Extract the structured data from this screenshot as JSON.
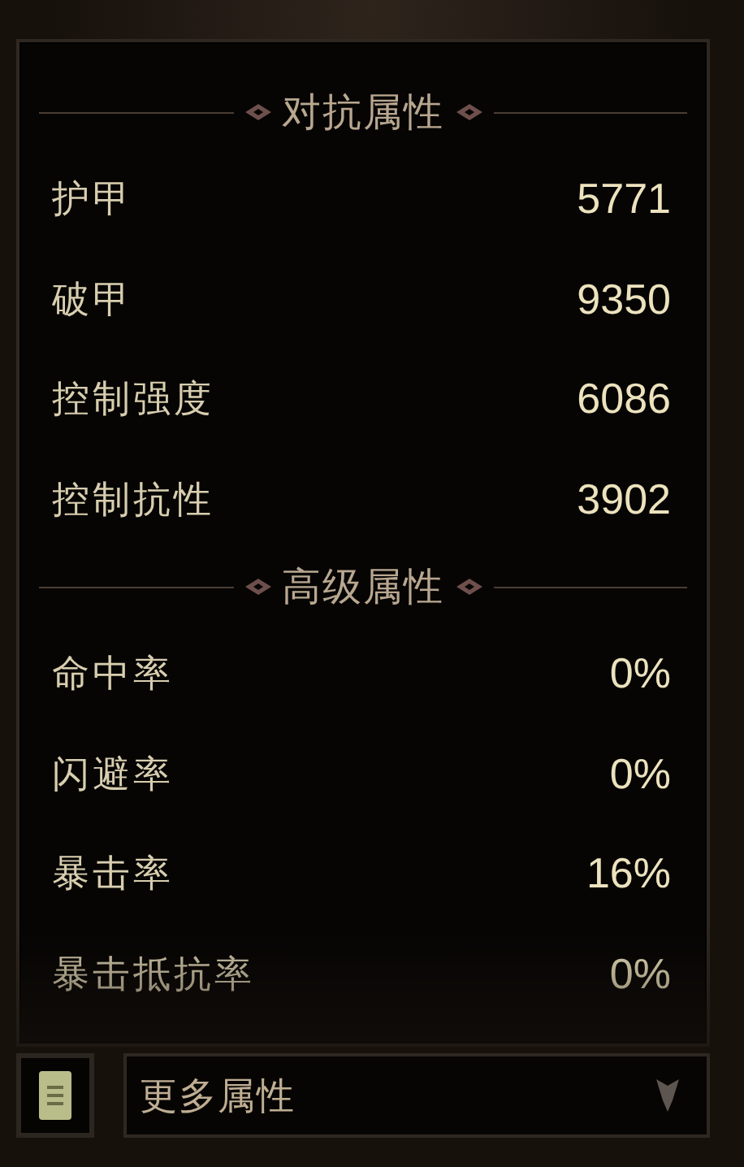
{
  "sections": [
    {
      "title": "对抗属性",
      "rows": [
        {
          "label": "护甲",
          "value": "5771"
        },
        {
          "label": "破甲",
          "value": "9350"
        },
        {
          "label": "控制强度",
          "value": "6086"
        },
        {
          "label": "控制抗性",
          "value": "3902"
        }
      ]
    },
    {
      "title": "高级属性",
      "rows": [
        {
          "label": "命中率",
          "value": "0%"
        },
        {
          "label": "闪避率",
          "value": "0%"
        },
        {
          "label": "暴击率",
          "value": "16%"
        },
        {
          "label": "暴击抵抗率",
          "value": "0%"
        }
      ]
    }
  ],
  "dropdown": {
    "label": "更多属性"
  }
}
